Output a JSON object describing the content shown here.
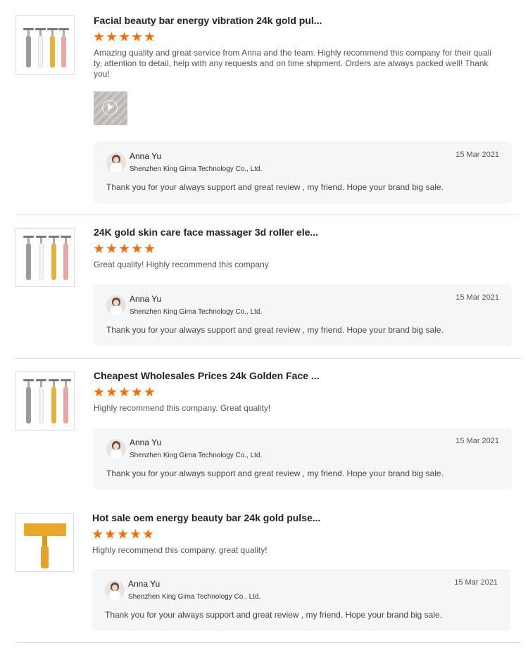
{
  "colors": {
    "star": "#ff6a00",
    "reply_bg": "#f5f6f8",
    "divider": "#dddddd"
  },
  "reviews": [
    {
      "title": "Facial beauty bar energy vibration 24k gold pul...",
      "rating": 5,
      "comment": "Amazing quality and great service from Anna and the team. Highly recommend this company for their quality, attention to detail, help with any requests and on time shipment. Orders are always packed well! Thank you!",
      "reply": {
        "name": "Anna Yu",
        "company": "Shenzhen King Gima Technology Co., Ltd.",
        "date": "15 Mar 2021",
        "text": "Thank you for your always support and great review , my friend. Hope your brand big sale."
      }
    },
    {
      "title": "24K gold skin care face massager 3d roller ele...",
      "rating": 5,
      "comment": "Great quality! Highly recommend this company",
      "reply": {
        "name": "Anna Yu",
        "company": "Shenzhen King Gima Technology Co., Ltd.",
        "date": "15 Mar 2021",
        "text": "Thank you for your always support and great review , my friend. Hope your brand big sale."
      }
    },
    {
      "title": "Cheapest Wholesales Prices 24k Golden Face ...",
      "rating": 5,
      "comment": "Highly recommend this company. Great quality!",
      "reply": {
        "name": "Anna Yu",
        "company": "Shenzhen King Gima Technology Co., Ltd.",
        "date": "15 Mar 2021",
        "text": "Thank you for your always support and great review , my friend. Hope your brand big sale."
      }
    },
    {
      "title": "Hot sale oem energy beauty bar 24k gold pulse...",
      "rating": 5,
      "comment": "Highly recommend this company, great quality!",
      "reply": {
        "name": "Anna Yu",
        "company": "Shenzhen King Gima Technology Co., Ltd.",
        "date": "15 Mar 2021",
        "text": "Thank you for your always support and great review , my friend. Hope your brand big sale."
      }
    }
  ]
}
